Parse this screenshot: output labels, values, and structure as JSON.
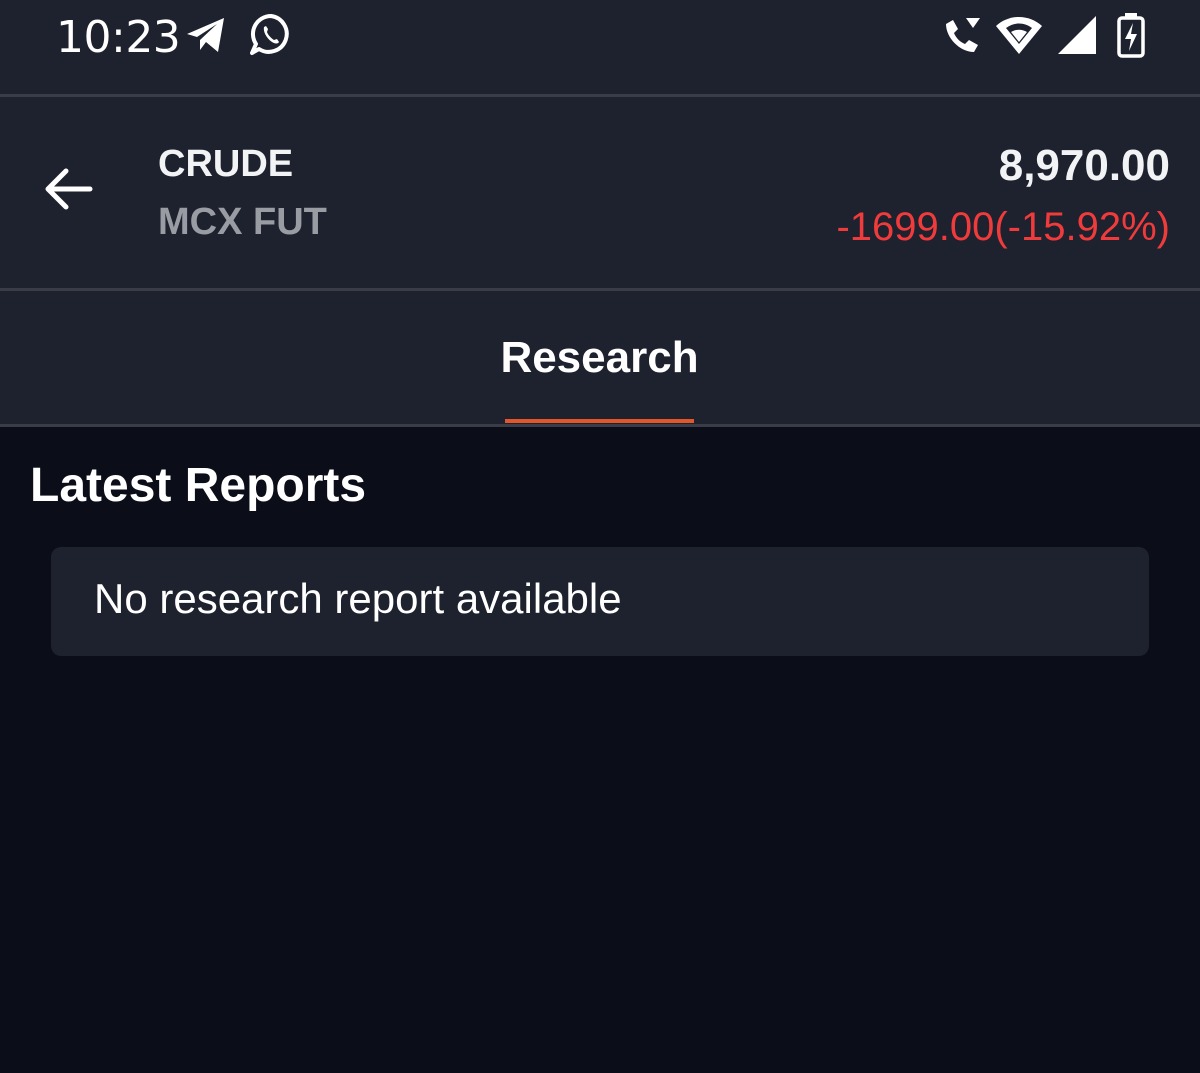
{
  "status_bar": {
    "time": "10:23",
    "left_icons": [
      "telegram-icon",
      "whatsapp-icon"
    ],
    "right_icons": [
      "wifi-calling-icon",
      "wifi-icon",
      "cellular-signal-icon",
      "battery-charging-icon"
    ]
  },
  "header": {
    "back_icon": "arrow-left-icon",
    "symbol": "CRUDE",
    "exchange": "MCX FUT",
    "price": "8,970.00",
    "change": "-1699.00(-15.92%)"
  },
  "tabs": [
    {
      "label": "Research",
      "active": true
    }
  ],
  "main": {
    "section_title": "Latest Reports",
    "empty_message": "No research report available"
  },
  "colors": {
    "background": "#0b0e18",
    "surface": "#1e212e",
    "accent": "#e2572a",
    "negative": "#ef3b3b",
    "muted": "#9a9ca4"
  }
}
